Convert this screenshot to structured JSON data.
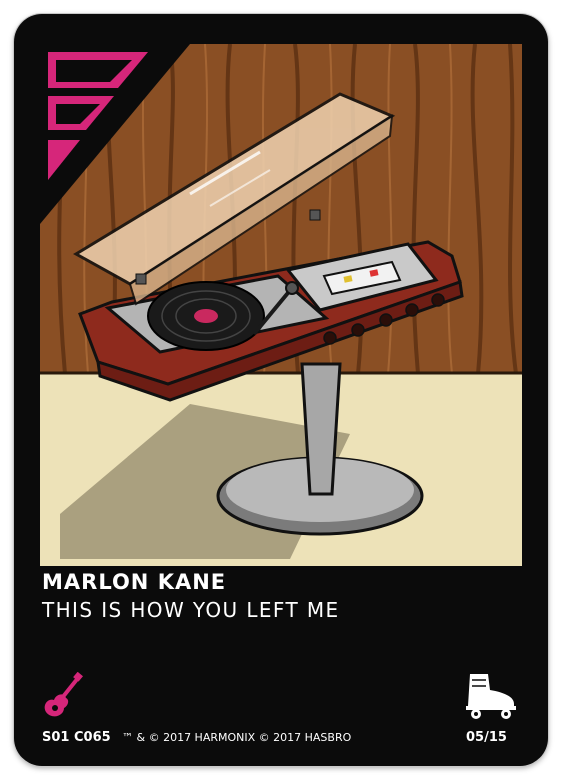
{
  "card": {
    "artist": "MARLON KANE",
    "song": "THIS IS HOW YOU LEFT ME",
    "code": "S01 C065",
    "legal": "™ & © 2017 HARMONIX  © 2017 HASBRO",
    "count": "05/15"
  },
  "icons": {
    "genre": "electric-guitar-icon",
    "theme": "roller-skate-icon",
    "rarity": "rarity-bars-icon"
  },
  "colors": {
    "accent": "#d6267a",
    "card_bg": "#0b0b0b",
    "text": "#ffffff"
  }
}
